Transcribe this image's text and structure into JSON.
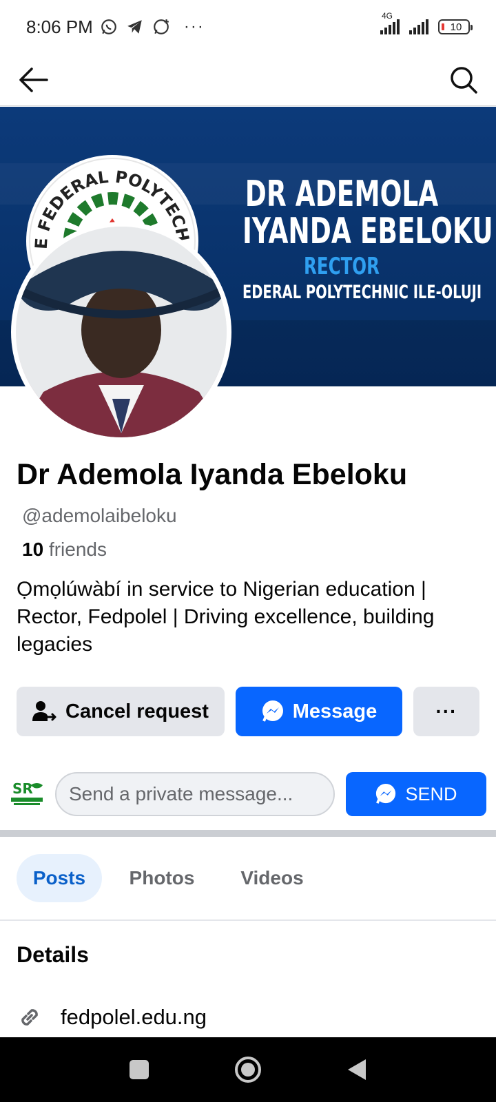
{
  "status_bar": {
    "time": "8:06 PM",
    "network_label": "4G",
    "battery_level": "10"
  },
  "header": {
    "back_icon": "arrow-left-icon",
    "search_icon": "search-icon"
  },
  "cover": {
    "name_line1": "DR ADEMOLA",
    "name_line2": "IYANDA EBELOKU",
    "role": "RECTOR",
    "institution": "EDERAL POLYTECHNIC ILE-OLUJI",
    "emblem_text": "THE FEDERAL POLYTECHNIC"
  },
  "profile": {
    "name": "Dr Ademola Iyanda Ebeloku",
    "handle": "@ademolaibeloku",
    "friends_count": "10",
    "friends_label": "friends",
    "bio": "Ọmọlúwàbí in service to Nigerian education | Rector, Fedpolel | Driving excellence, building legacies"
  },
  "actions": {
    "cancel_request_label": "Cancel request",
    "message_label": "Message",
    "more_label": "···"
  },
  "private_message": {
    "placeholder": "Send a private message...",
    "send_label": "SEND"
  },
  "tabs": [
    {
      "label": "Posts",
      "active": true
    },
    {
      "label": "Photos",
      "active": false
    },
    {
      "label": "Videos",
      "active": false
    }
  ],
  "details": {
    "title": "Details",
    "website": "fedpolel.edu.ng"
  },
  "colors": {
    "primary_blue": "#0866ff",
    "cover_blue": "#0a3570",
    "tab_active_bg": "#e7f1fd",
    "tab_active_text": "#0a60c9"
  }
}
